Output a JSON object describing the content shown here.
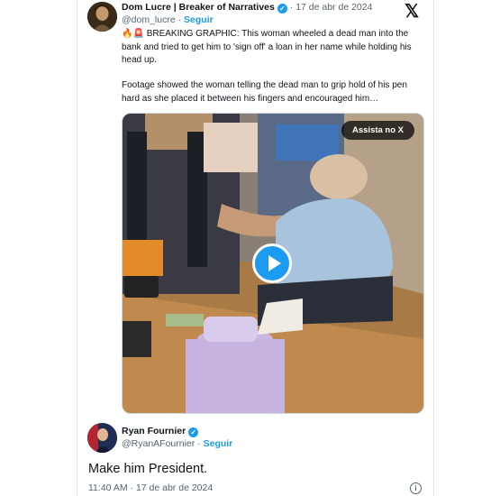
{
  "tweet": {
    "author_name": "Dom Lucre | Breaker of Narratives",
    "handle": "@dom_lucre",
    "follow_label": "Seguir",
    "date": "17 de abr de 2024",
    "paragraph1_emoji": "🔥🚨",
    "paragraph1": "BREAKING GRAPHIC: This woman wheeled a dead man into the bank and tried to get him to 'sign off' a loan in her name while holding his head up.",
    "paragraph2": "Footage showed the woman telling the dead man to grip hold of his pen hard as she placed it between his fingers and encouraged him…",
    "media_button": "Assista no X"
  },
  "reply": {
    "author_name": "Ryan Fournier",
    "handle": "@RyanAFournier",
    "follow_label": "Seguir",
    "text": "Make him President.",
    "time": "11:40 AM",
    "date": "17 de abr de 2024",
    "separator": "·"
  },
  "icons": {
    "x_logo": "x-logo-icon",
    "verified": "verified-badge-icon",
    "play": "play-icon",
    "info": "info-icon"
  },
  "colors": {
    "accent": "#1d9bf0",
    "text": "#0f1419",
    "muted": "#536471"
  }
}
